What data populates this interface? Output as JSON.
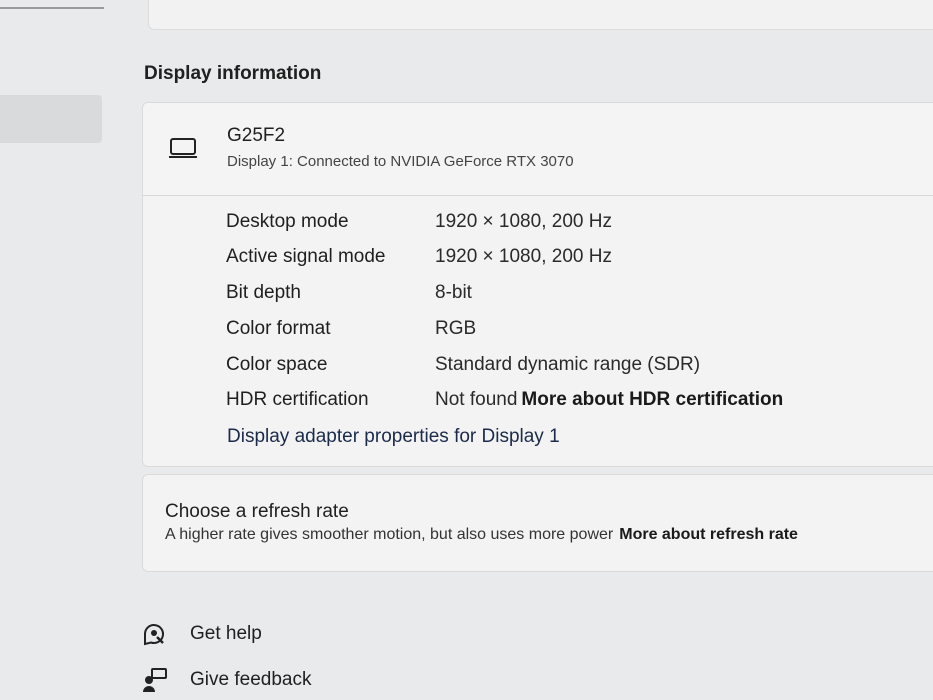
{
  "section": {
    "title": "Display information"
  },
  "display": {
    "name": "G25F2",
    "connection": "Display 1: Connected to NVIDIA GeForce RTX 3070",
    "properties": [
      {
        "label": "Desktop mode",
        "value": "1920 × 1080, 200 Hz"
      },
      {
        "label": "Active signal mode",
        "value": "1920 × 1080, 200 Hz"
      },
      {
        "label": "Bit depth",
        "value": "8-bit"
      },
      {
        "label": "Color format",
        "value": "RGB"
      },
      {
        "label": "Color space",
        "value": "Standard dynamic range (SDR)"
      },
      {
        "label": "HDR certification",
        "value": "Not found",
        "link": "More about HDR certification"
      }
    ],
    "adapter_link": "Display adapter properties for Display 1",
    "icon": "monitor-icon"
  },
  "refresh": {
    "title": "Choose a refresh rate",
    "description": "A higher rate gives smoother motion, but also uses more power",
    "link": "More about refresh rate"
  },
  "help": {
    "get_help": "Get help",
    "give_feedback": "Give feedback",
    "get_help_icon": "help-icon",
    "feedback_icon": "feedback-icon"
  }
}
